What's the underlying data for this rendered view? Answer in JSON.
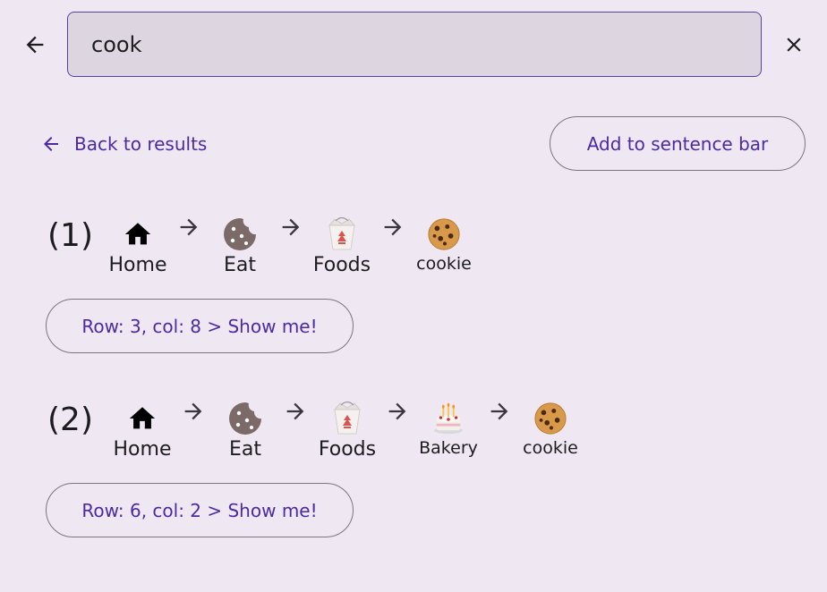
{
  "search": {
    "value": "cook"
  },
  "actions": {
    "back_to_results": "Back to results",
    "add_to_sentence_bar": "Add to sentence bar"
  },
  "results": [
    {
      "number": "(1)",
      "path": [
        {
          "label": "Home",
          "icon": "home-icon"
        },
        {
          "label": "Eat",
          "icon": "cookie-silhouette-icon"
        },
        {
          "label": "Foods",
          "icon": "takeout-box-icon"
        },
        {
          "label": "cookie",
          "icon": "cookie-icon"
        }
      ],
      "show_me": "Row: 3, col: 8 > Show me!"
    },
    {
      "number": "(2)",
      "path": [
        {
          "label": "Home",
          "icon": "home-icon"
        },
        {
          "label": "Eat",
          "icon": "cookie-silhouette-icon"
        },
        {
          "label": "Foods",
          "icon": "takeout-box-icon"
        },
        {
          "label": "Bakery",
          "icon": "birthday-cake-icon"
        },
        {
          "label": "cookie",
          "icon": "cookie-icon"
        }
      ],
      "show_me": "Row: 6, col: 2 > Show me!"
    }
  ],
  "colors": {
    "accent": "#4b2aa3",
    "background": "#efe8f3",
    "search_fill": "#ddd6e1",
    "eat_icon": "#7b6a67"
  }
}
